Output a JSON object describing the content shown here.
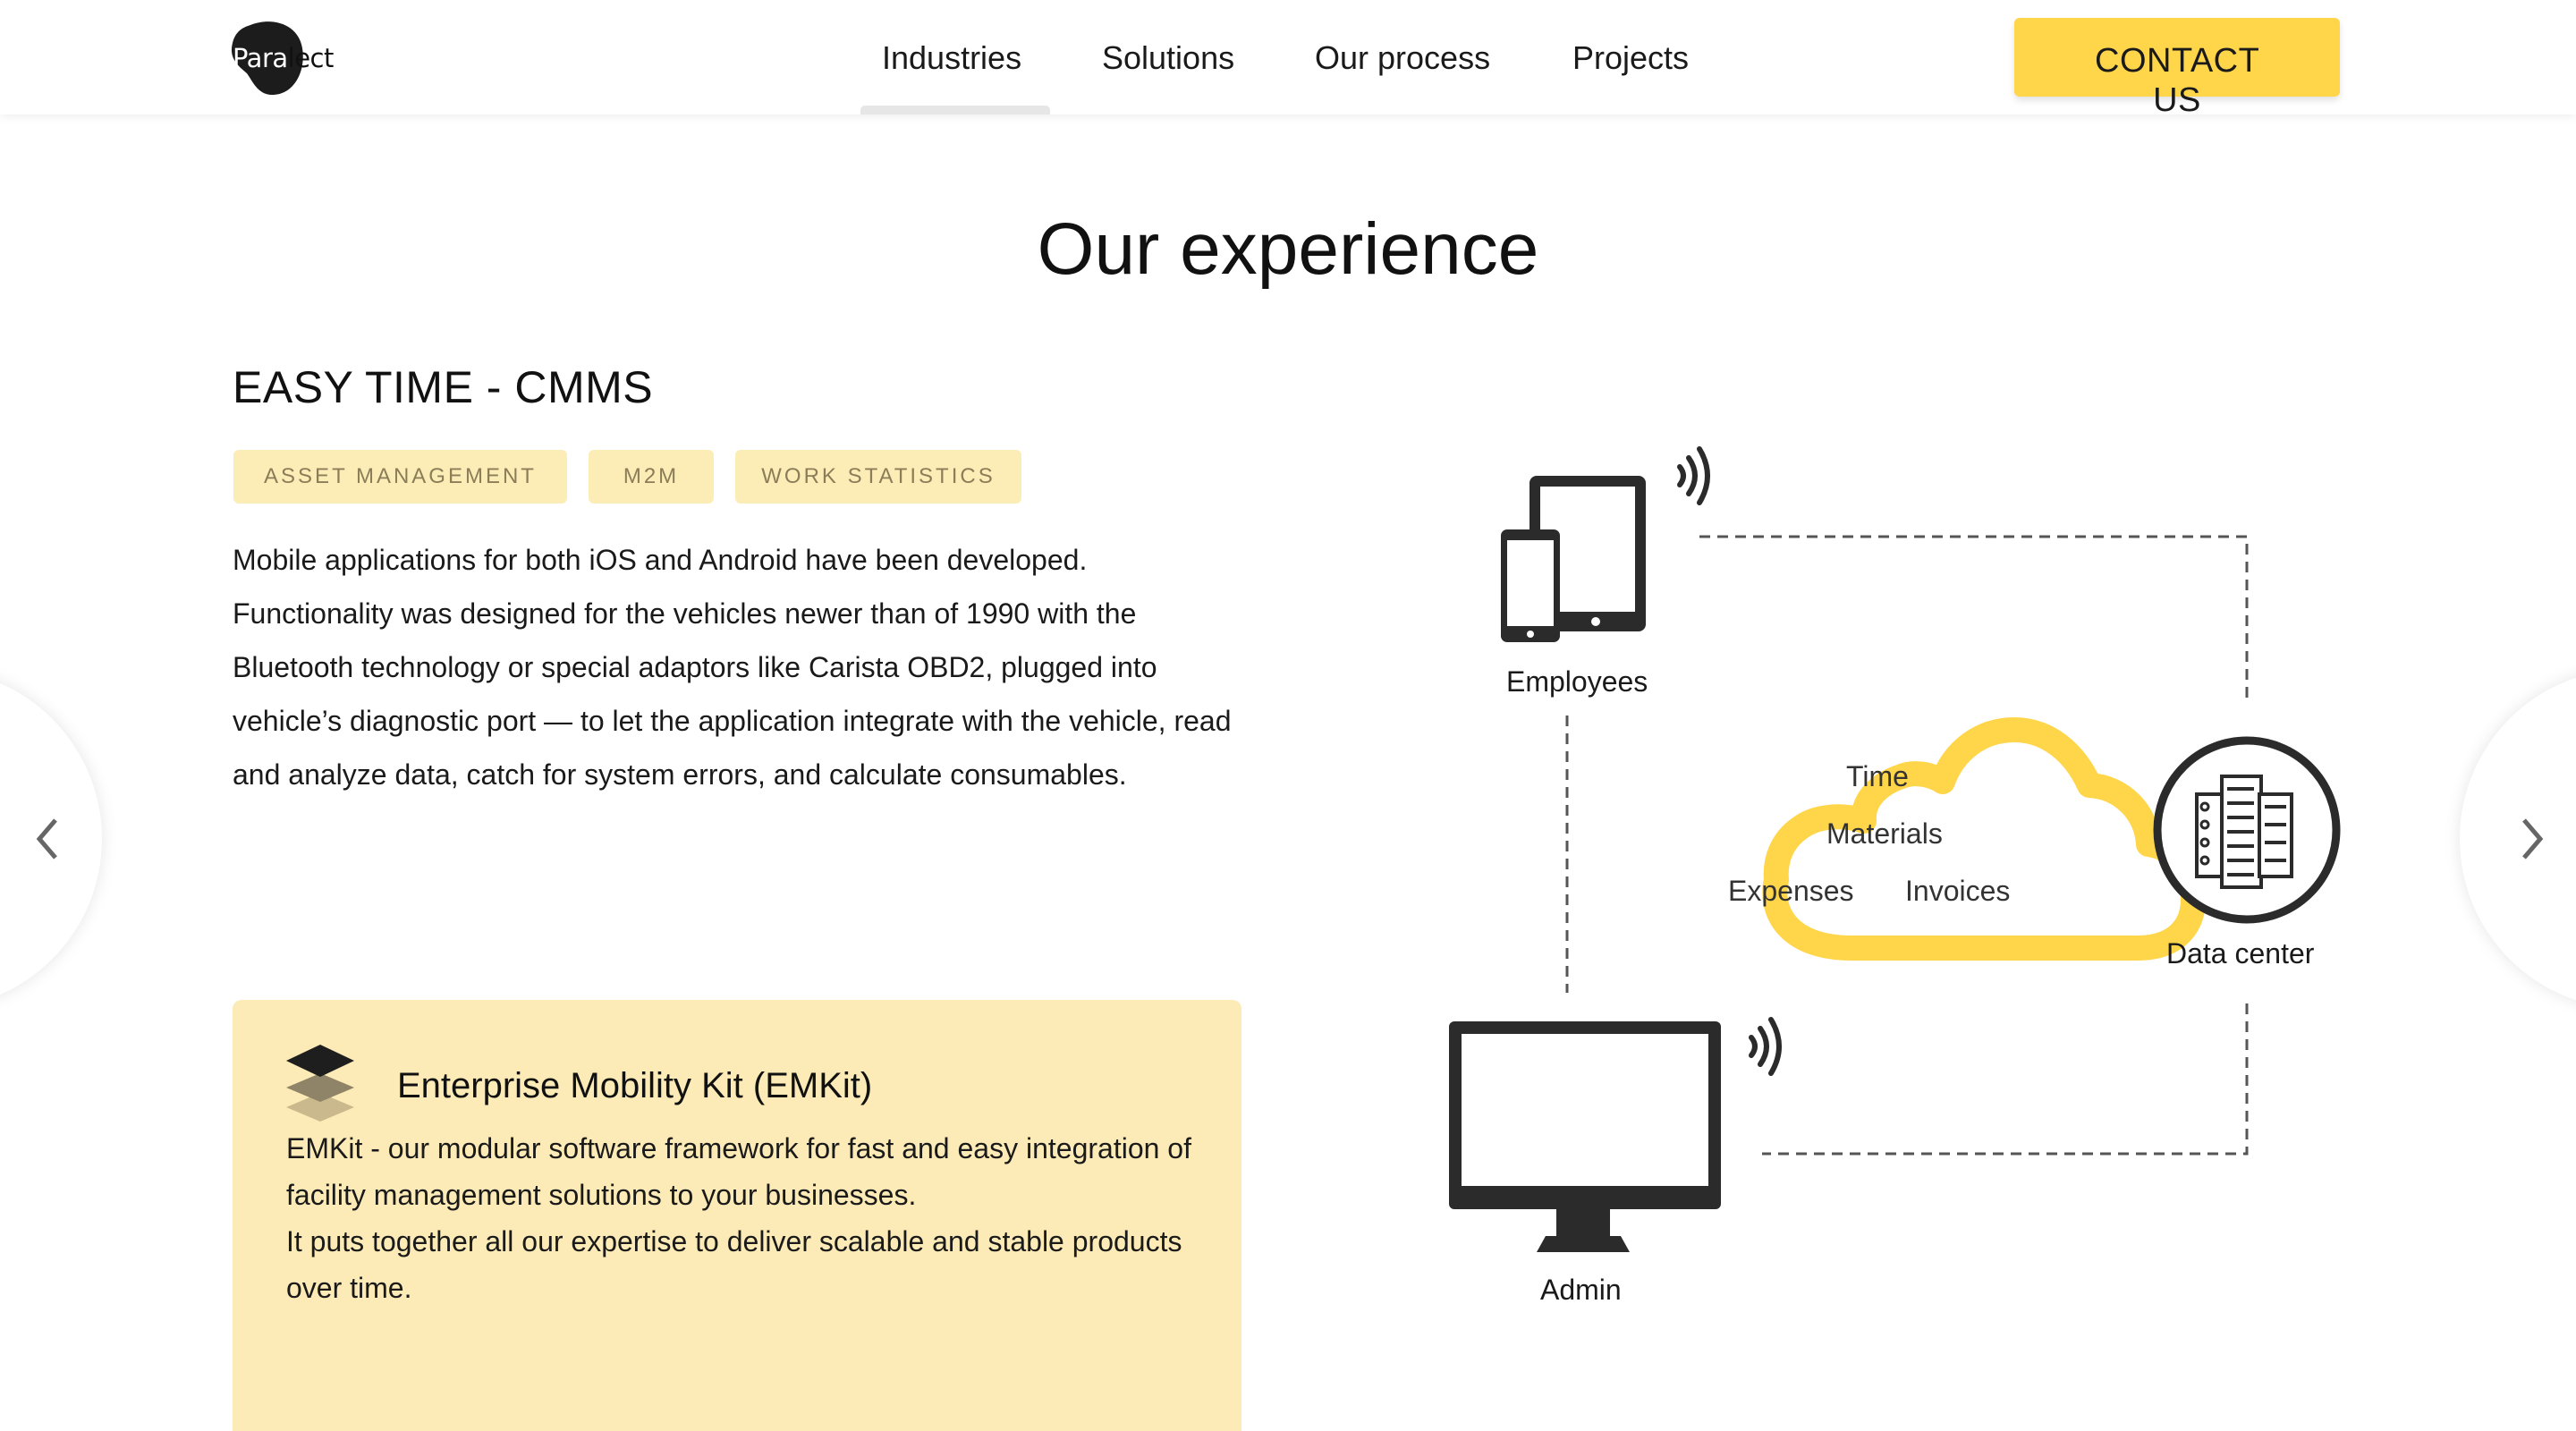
{
  "header": {
    "logo_text_light": "Para",
    "logo_text_dark": "lect",
    "nav": [
      "Industries",
      "Solutions",
      "Our process",
      "Projects"
    ],
    "contact_label": "CONTACT US"
  },
  "section": {
    "title": "Our experience"
  },
  "project": {
    "title": "EASY TIME - CMMS",
    "tags": [
      "ASSET MANAGEMENT",
      "M2M",
      "WORK STATISTICS"
    ],
    "description": "Mobile applications for both iOS and Android have been developed. Functionality was designed for the vehicles newer than of 1990 with the Bluetooth technology or special adaptors like Carista OBD2, plugged into vehicle’s diagnostic port — to let the application integrate with the vehicle, read and analyze data, catch for system errors, and calculate consumables."
  },
  "emkit": {
    "title": "Enterprise Mobility Kit (EMKit)",
    "line1": "EMKit - our modular software framework for fast and easy integration of facility management solutions to your businesses.",
    "line2": "It puts together all our expertise to deliver scalable and stable products over time."
  },
  "diagram": {
    "employees": "Employees",
    "admin": "Admin",
    "data_center": "Data center",
    "cloud_items": [
      "Time",
      "Materials",
      "Expenses",
      "Invoices"
    ],
    "accent_color": "#ffd54a",
    "icon_color": "#2b2b2b"
  }
}
